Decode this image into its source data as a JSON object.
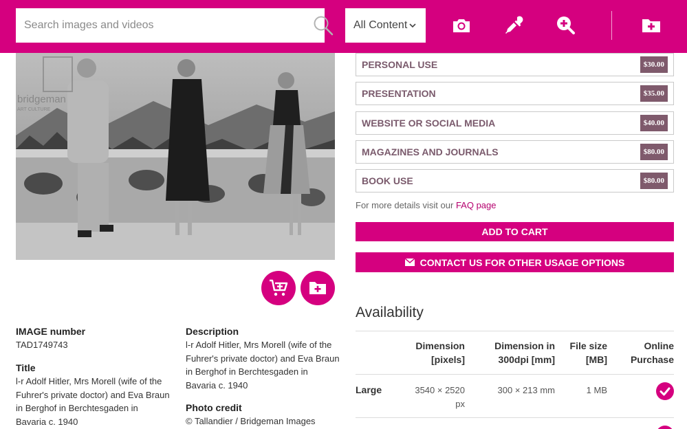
{
  "header": {
    "search_placeholder": "Search images and videos",
    "content_filter": "All Content",
    "icons": [
      "search-icon",
      "camera-icon",
      "eyedropper-icon",
      "zoom-plus-icon",
      "folder-plus-icon"
    ],
    "brand_color": "#d5007f"
  },
  "image": {
    "watermark": "bridgeman",
    "watermark_sub": "ART CULTURE",
    "alt": "Black and white photograph"
  },
  "actions": {
    "icons": [
      "cart-plus-icon",
      "folder-plus-icon"
    ]
  },
  "metadata": {
    "image_number_label": "IMAGE number",
    "image_number": "TAD1749743",
    "title_label": "Title",
    "title_lines": [
      "l-r Adolf Hitler, Mrs Morell (wife of the",
      "Fuhrer's private doctor) and Eva Braun",
      "in Berghof in Berchtesgaden in",
      "Bavaria c. 1940"
    ],
    "description_label": "Description",
    "description_lines": [
      "l-r Adolf Hitler, Mrs Morell (wife of the",
      "Fuhrer's private doctor) and Eva Braun",
      "in Berghof in Berchtesgaden in",
      "Bavaria c. 1940"
    ],
    "photo_credit_label": "Photo credit",
    "photo_credit": "© Tallandier / Bridgeman Images"
  },
  "licences": [
    {
      "label": "PERSONAL USE",
      "price": "$30.00"
    },
    {
      "label": "PRESENTATION",
      "price": "$35.00"
    },
    {
      "label": "WEBSITE OR SOCIAL MEDIA",
      "price": "$40.00"
    },
    {
      "label": "MAGAZINES AND JOURNALS",
      "price": "$80.00"
    },
    {
      "label": "BOOK USE",
      "price": "$80.00"
    }
  ],
  "faq": {
    "prefix": "For more details visit our",
    "link": "FAQ page"
  },
  "buttons": {
    "add_to_cart": "ADD TO CART",
    "contact": "CONTACT US FOR OTHER USAGE OPTIONS"
  },
  "availability": {
    "title": "Availability",
    "headers": {
      "dimension_px": [
        "Dimension",
        "[pixels]"
      ],
      "dimension_mm": [
        "Dimension in",
        "300dpi [mm]"
      ],
      "file_size": [
        "File size",
        "[MB]"
      ],
      "online": [
        "Online",
        "Purchase"
      ]
    },
    "rows": [
      {
        "label": "Large",
        "pixels_line1": "3540 × 2520",
        "pixels_line2": "px",
        "mm": "300 × 213 mm",
        "size": "1 MB",
        "online": true
      }
    ]
  }
}
